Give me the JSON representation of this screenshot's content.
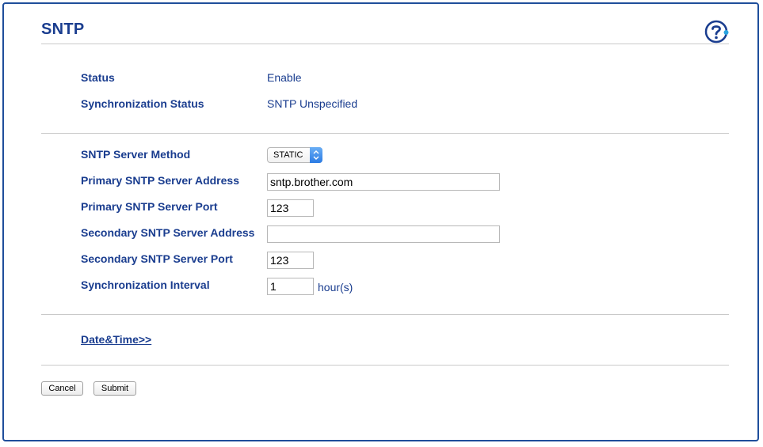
{
  "page": {
    "title": "SNTP",
    "help_icon": "help-question-icon"
  },
  "status": {
    "status_label": "Status",
    "status_value": "Enable",
    "sync_status_label": "Synchronization Status",
    "sync_status_value": "SNTP Unspecified"
  },
  "form": {
    "server_method_label": "SNTP Server Method",
    "server_method_value": "STATIC",
    "primary_address_label": "Primary SNTP Server Address",
    "primary_address_value": "sntp.brother.com",
    "primary_port_label": "Primary SNTP Server Port",
    "primary_port_value": "123",
    "secondary_address_label": "Secondary SNTP Server Address",
    "secondary_address_value": "",
    "secondary_port_label": "Secondary SNTP Server Port",
    "secondary_port_value": "123",
    "sync_interval_label": "Synchronization Interval",
    "sync_interval_value": "1",
    "sync_interval_unit": "hour(s)"
  },
  "links": {
    "date_time": "Date&Time>>"
  },
  "buttons": {
    "cancel": "Cancel",
    "submit": "Submit"
  },
  "colors": {
    "accent": "#1a3d8f",
    "frame_border": "#1f4e9b",
    "select_arrow": "#2b7be4"
  }
}
